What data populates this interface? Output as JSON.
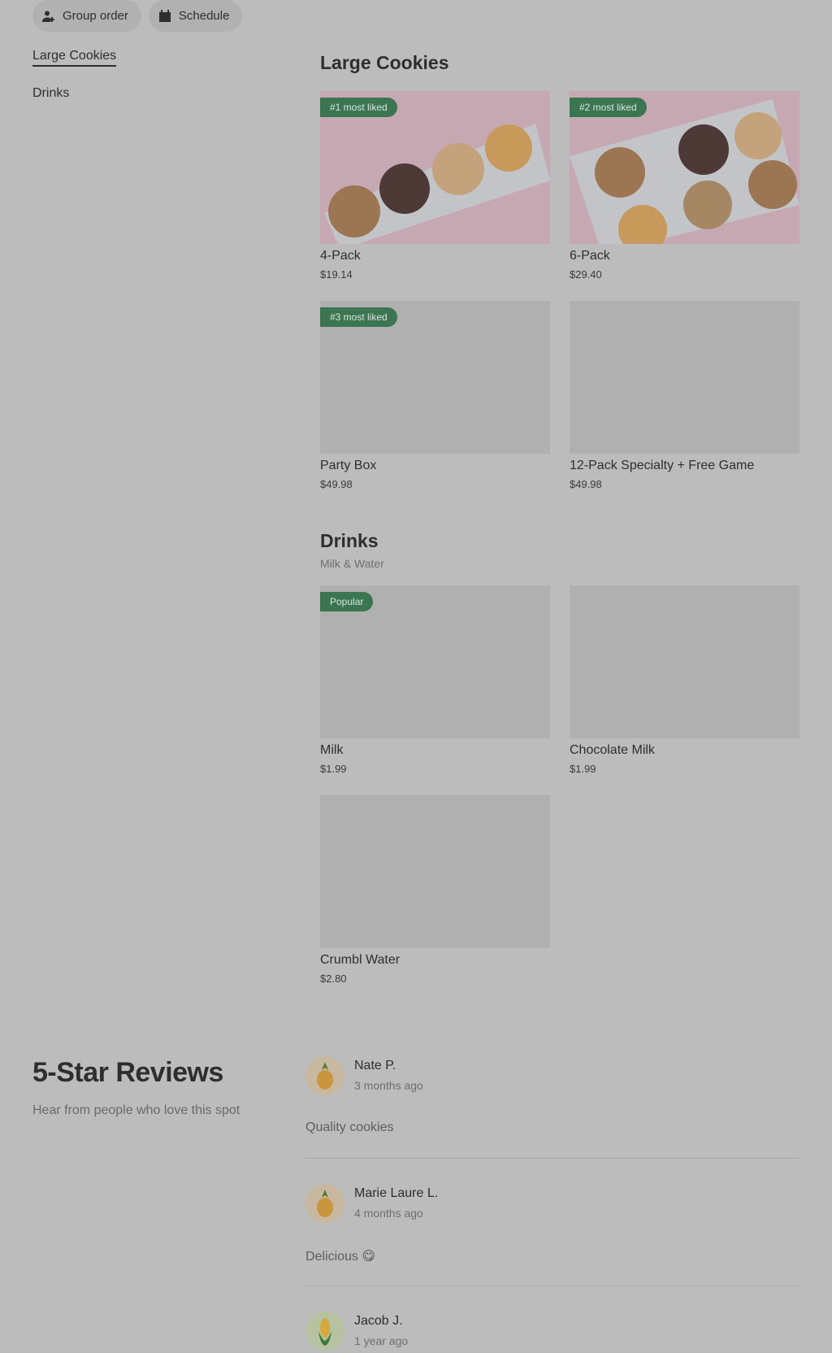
{
  "top_actions": {
    "group_order_label": "Group order",
    "schedule_label": "Schedule"
  },
  "side_nav": {
    "items": [
      {
        "label": "Large Cookies"
      },
      {
        "label": "Drinks"
      }
    ]
  },
  "sections": {
    "large_cookies": {
      "title": "Large Cookies",
      "items": [
        {
          "name": "4-Pack",
          "price": "$19.14",
          "badge": "#1 most liked"
        },
        {
          "name": "6-Pack",
          "price": "$29.40",
          "badge": "#2 most liked"
        },
        {
          "name": "Party Box",
          "price": "$49.98",
          "badge": "#3 most liked"
        },
        {
          "name": "12-Pack Specialty + Free Game",
          "price": "$49.98"
        }
      ]
    },
    "drinks": {
      "title": "Drinks",
      "subtitle": "Milk & Water",
      "items": [
        {
          "name": "Milk",
          "price": "$1.99",
          "badge": "Popular"
        },
        {
          "name": "Chocolate Milk",
          "price": "$1.99"
        },
        {
          "name": "Crumbl Water",
          "price": "$2.80"
        }
      ]
    }
  },
  "reviews": {
    "title": "5-Star Reviews",
    "subtitle": "Hear from people who love this spot",
    "items": [
      {
        "name": "Nate P.",
        "time": "3 months ago",
        "text": "Quality cookies",
        "avatar_icon": "pineapple-icon"
      },
      {
        "name": "Marie Laure L.",
        "time": "4 months ago",
        "text": "Delicious 😋",
        "avatar_icon": "pineapple-icon"
      },
      {
        "name": "Jacob J.",
        "time": "1 year ago",
        "text": "",
        "avatar_icon": "corn-icon"
      }
    ]
  },
  "colors": {
    "badge": "#3b7551",
    "overlay_background": "#bcbcbc"
  }
}
